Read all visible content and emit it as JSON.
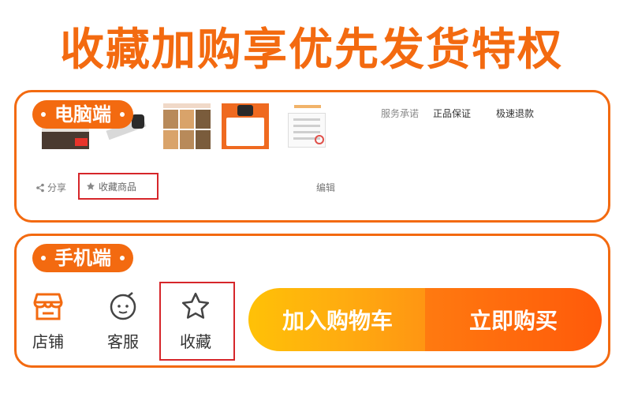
{
  "headline": "收藏加购享优先发货特权",
  "pc_panel": {
    "tag": "电脑端",
    "services": [
      "服务承诺",
      "正品保证",
      "极速退款"
    ],
    "share_label": "分享",
    "favorite_label": "收藏商品",
    "edit_label": "编辑"
  },
  "mobile_panel": {
    "tag": "手机端",
    "shop_label": "店铺",
    "service_label": "客服",
    "favorite_label": "收藏",
    "add_to_cart_label": "加入购物车",
    "buy_now_label": "立即购买"
  },
  "colors": {
    "accent": "#f36a10",
    "highlight_border": "#d6262a",
    "cart_gradient": [
      "#ffc107",
      "#ff9512"
    ],
    "buy_gradient": [
      "#ff7a10",
      "#ff5a0a"
    ]
  },
  "icons": [
    "share-icon",
    "star-icon",
    "store-icon",
    "chat-icon",
    "star-outline-icon"
  ]
}
